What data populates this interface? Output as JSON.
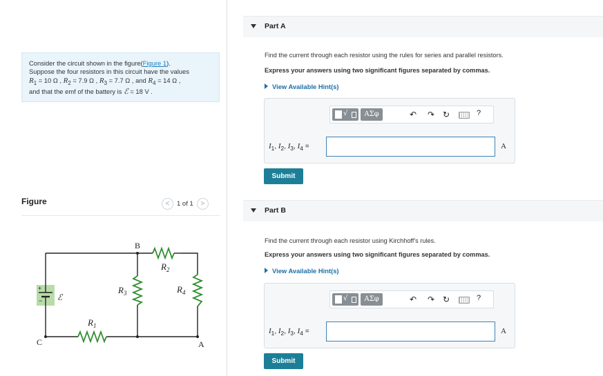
{
  "problem": {
    "line1_text": "Consider the circuit shown in the figure(",
    "figure_link": "Figure 1",
    "line1_end": ").",
    "line2": "Suppose the four resistors in this circuit have the values",
    "r1_label": "R",
    "r1_sub": "1",
    "r1_value": " = 10 Ω , ",
    "r2_sub": "2",
    "r2_value": " = 7.9 Ω , ",
    "r3_sub": "3",
    "r3_value": " = 7.7 Ω , and ",
    "r4_sub": "4",
    "r4_value": " = 14 Ω ,",
    "line4_text": "and that the emf of the battery is ",
    "emf_symbol": "ℰ",
    "emf_value": " = 18 V ."
  },
  "figure": {
    "title": "Figure",
    "pager_text": "1 of 1",
    "prev_glyph": "<",
    "next_glyph": ">",
    "circuit_labels": {
      "B": "B",
      "A": "A",
      "C": "C",
      "R": "R",
      "R1": "1",
      "R2": "2",
      "R3": "3",
      "R4": "4",
      "emf": "ℰ",
      "plus": "+",
      "minus": "−"
    },
    "colors": {
      "wire": "#222222",
      "resistor": "#2f8d2f",
      "battery_bg": "#b8dca8",
      "node": "#222222"
    }
  },
  "parts": [
    {
      "label": "Part A",
      "instruction": "Find the current through each resistor using the rules for series and parallel resistors.",
      "format": "Express your answers using two significant figures separated by commas.",
      "hint": "View Available Hint(s)",
      "equation_vars": [
        "I",
        "1",
        "I",
        "2",
        "I",
        "3",
        "I",
        "4"
      ],
      "equation_seps": [
        ", ",
        ", ",
        ", ",
        " ="
      ],
      "input_value": "",
      "unit": "A",
      "submit": "Submit"
    },
    {
      "label": "Part B",
      "instruction": "Find the current through each resistor using Kirchhoff's rules.",
      "format": "Express your answers using two significant figures separated by commas.",
      "hint": "View Available Hint(s)",
      "equation_vars": [
        "I",
        "1",
        "I",
        "2",
        "I",
        "3",
        "I",
        "4"
      ],
      "equation_seps": [
        ", ",
        ", ",
        ", ",
        " ="
      ],
      "input_value": "",
      "unit": "A",
      "submit": "Submit"
    }
  ],
  "toolbar": {
    "templates_icon": "templates-icon",
    "root_glyph": "√",
    "greek_label": "ΑΣφ",
    "undo_glyph": "↶",
    "redo_glyph": "↷",
    "reset_glyph": "↻",
    "keyboard_icon": "keyboard-icon",
    "help_glyph": "?"
  },
  "colors": {
    "accent": "#1d7f97",
    "link": "#1c6fa8",
    "problem_bg": "#e9f4fb",
    "part_bar_bg": "#f4f6f7"
  }
}
